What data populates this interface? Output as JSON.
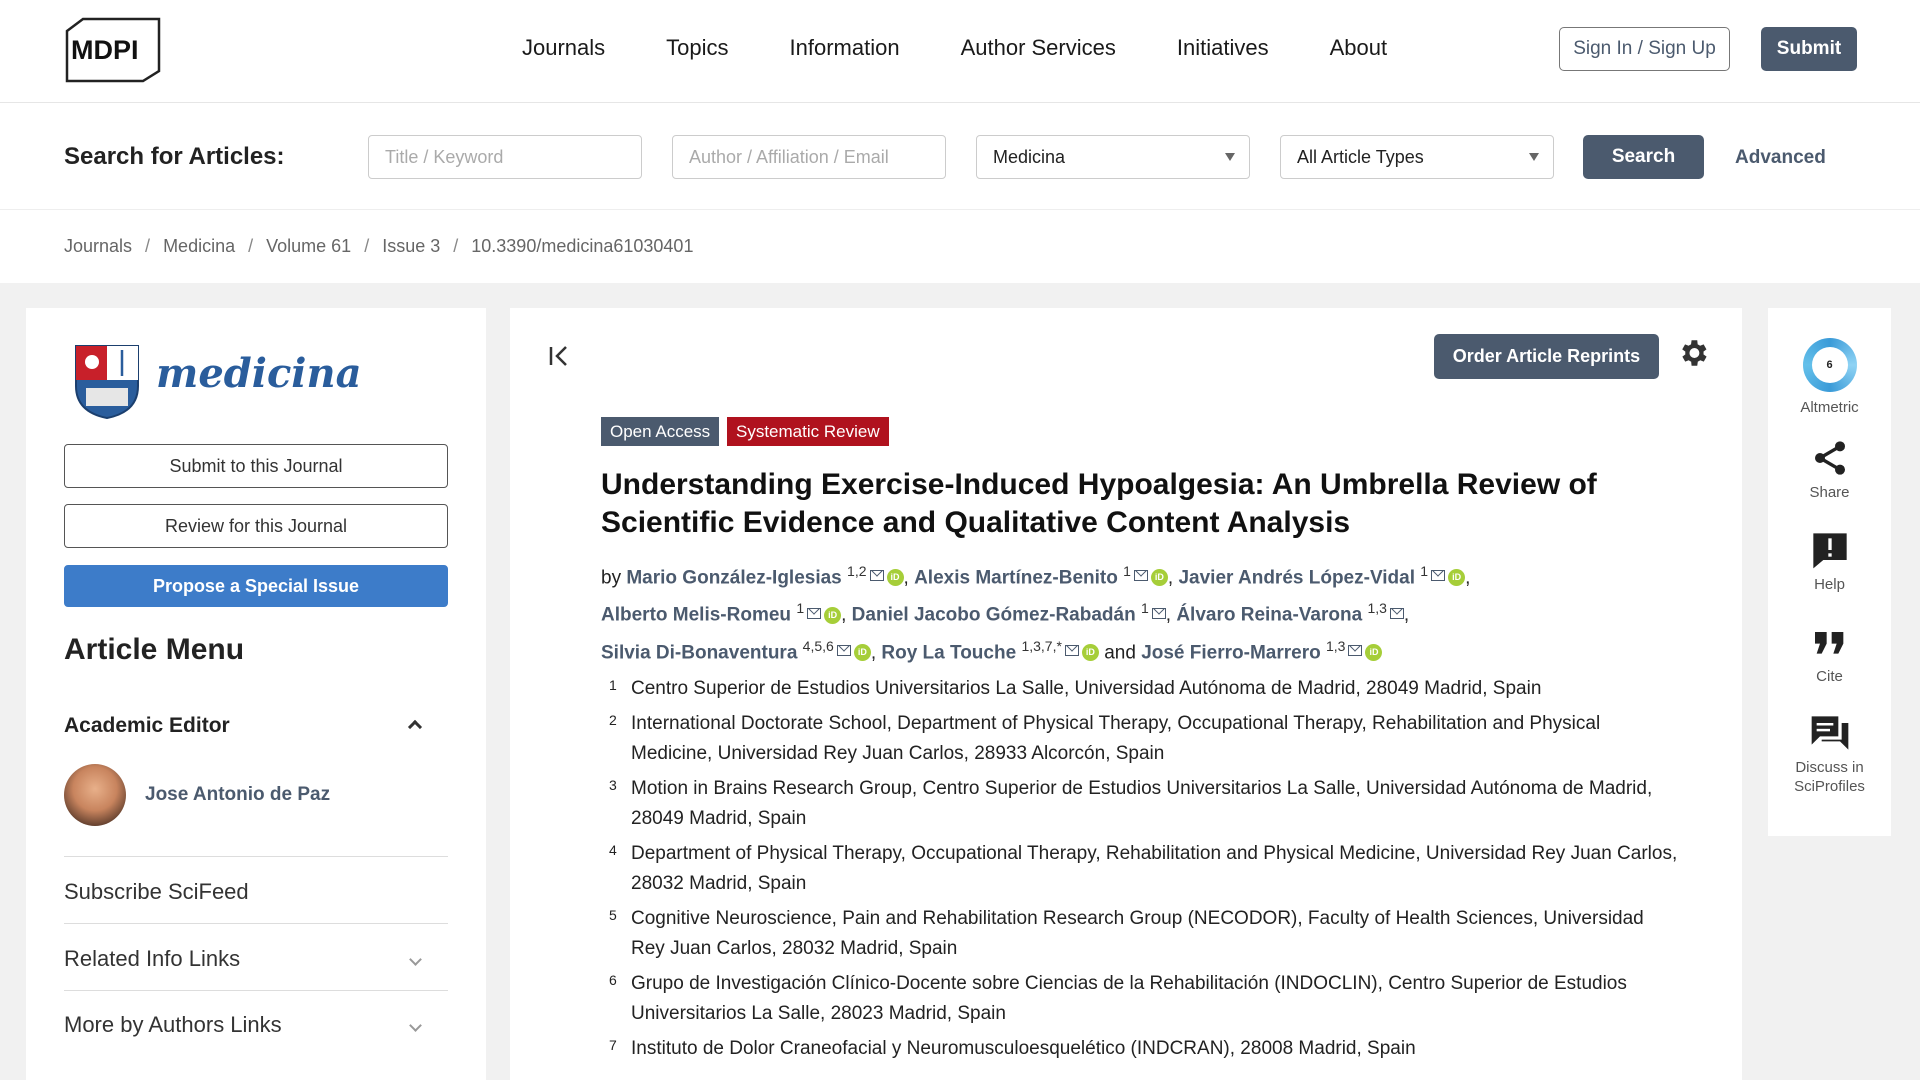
{
  "header": {
    "logo_text": "MDPI",
    "nav": [
      "Journals",
      "Topics",
      "Information",
      "Author Services",
      "Initiatives",
      "About"
    ],
    "signin_label": "Sign In / Sign Up",
    "submit_label": "Submit"
  },
  "search": {
    "label": "Search for Articles:",
    "keyword_placeholder": "Title / Keyword",
    "author_placeholder": "Author / Affiliation / Email",
    "journal_selected": "Medicina",
    "article_type_selected": "All Article Types",
    "search_label": "Search",
    "advanced_label": "Advanced"
  },
  "breadcrumb": [
    "Journals",
    "Medicina",
    "Volume 61",
    "Issue 3",
    "10.3390/medicina61030401"
  ],
  "sidebar": {
    "journal_name": "medicina",
    "submit_label": "Submit to this Journal",
    "review_label": "Review for this Journal",
    "propose_label": "Propose a Special Issue",
    "article_menu": "Article Menu",
    "academic_editor_heading": "Academic Editor",
    "editor_name": "Jose Antonio de Paz",
    "menu_items": [
      "Subscribe SciFeed",
      "Related Info Links",
      "More by Authors Links"
    ]
  },
  "article": {
    "reprints_label": "Order Article Reprints",
    "badges": {
      "open_access": "Open Access",
      "type": "Systematic Review"
    },
    "title": "Understanding Exercise-Induced Hypoalgesia: An Umbrella Review of Scientific Evidence and Qualitative Content Analysis",
    "by": "by",
    "and": "and",
    "authors": [
      {
        "name": "Mario González-Iglesias",
        "sup": "1,2",
        "orcid": true
      },
      {
        "name": "Alexis Martínez-Benito",
        "sup": "1",
        "orcid": true
      },
      {
        "name": "Javier Andrés López-Vidal",
        "sup": "1",
        "orcid": true
      },
      {
        "name": "Alberto Melis-Romeu",
        "sup": "1",
        "orcid": true
      },
      {
        "name": "Daniel Jacobo Gómez-Rabadán",
        "sup": "1",
        "orcid": false
      },
      {
        "name": "Álvaro Reina-Varona",
        "sup": "1,3",
        "orcid": false
      },
      {
        "name": "Silvia Di-Bonaventura",
        "sup": "4,5,6",
        "orcid": true
      },
      {
        "name": "Roy La Touche",
        "sup": "1,3,7,*",
        "orcid": true
      },
      {
        "name": "José Fierro-Marrero",
        "sup": "1,3",
        "orcid": true
      }
    ],
    "affiliations": [
      {
        "num": "1",
        "text": "Centro Superior de Estudios Universitarios La Salle, Universidad Autónoma de Madrid, 28049 Madrid, Spain"
      },
      {
        "num": "2",
        "text": "International Doctorate School, Department of Physical Therapy, Occupational Therapy, Rehabilitation and Physical Medicine, Universidad Rey Juan Carlos, 28933 Alcorcón, Spain"
      },
      {
        "num": "3",
        "text": "Motion in Brains Research Group, Centro Superior de Estudios Universitarios La Salle, Universidad Autónoma de Madrid, 28049 Madrid, Spain"
      },
      {
        "num": "4",
        "text": "Department of Physical Therapy, Occupational Therapy, Rehabilitation and Physical Medicine, Universidad Rey Juan Carlos, 28032 Madrid, Spain"
      },
      {
        "num": "5",
        "text": "Cognitive Neuroscience, Pain and Rehabilitation Research Group (NECODOR), Faculty of Health Sciences, Universidad Rey Juan Carlos, 28032 Madrid, Spain"
      },
      {
        "num": "6",
        "text": "Grupo de Investigación Clínico-Docente sobre Ciencias de la Rehabilitación (INDOCLIN), Centro Superior de Estudios Universitarios La Salle, 28023 Madrid, Spain"
      },
      {
        "num": "7",
        "text": "Instituto de Dolor Craneofacial y Neuromusculoesquelético (INDCRAN), 28008 Madrid, Spain"
      }
    ]
  },
  "rightbar": {
    "altmetric_score": "6",
    "altmetric_label": "Altmetric",
    "share_label": "Share",
    "help_label": "Help",
    "cite_label": "Cite",
    "discuss_label": "Discuss in SciProfiles"
  },
  "colors": {
    "primary": "#4b5a6e",
    "propose_blue": "#3d7cc9",
    "review_red": "#b0121e",
    "orcid_green": "#a6ce39"
  }
}
